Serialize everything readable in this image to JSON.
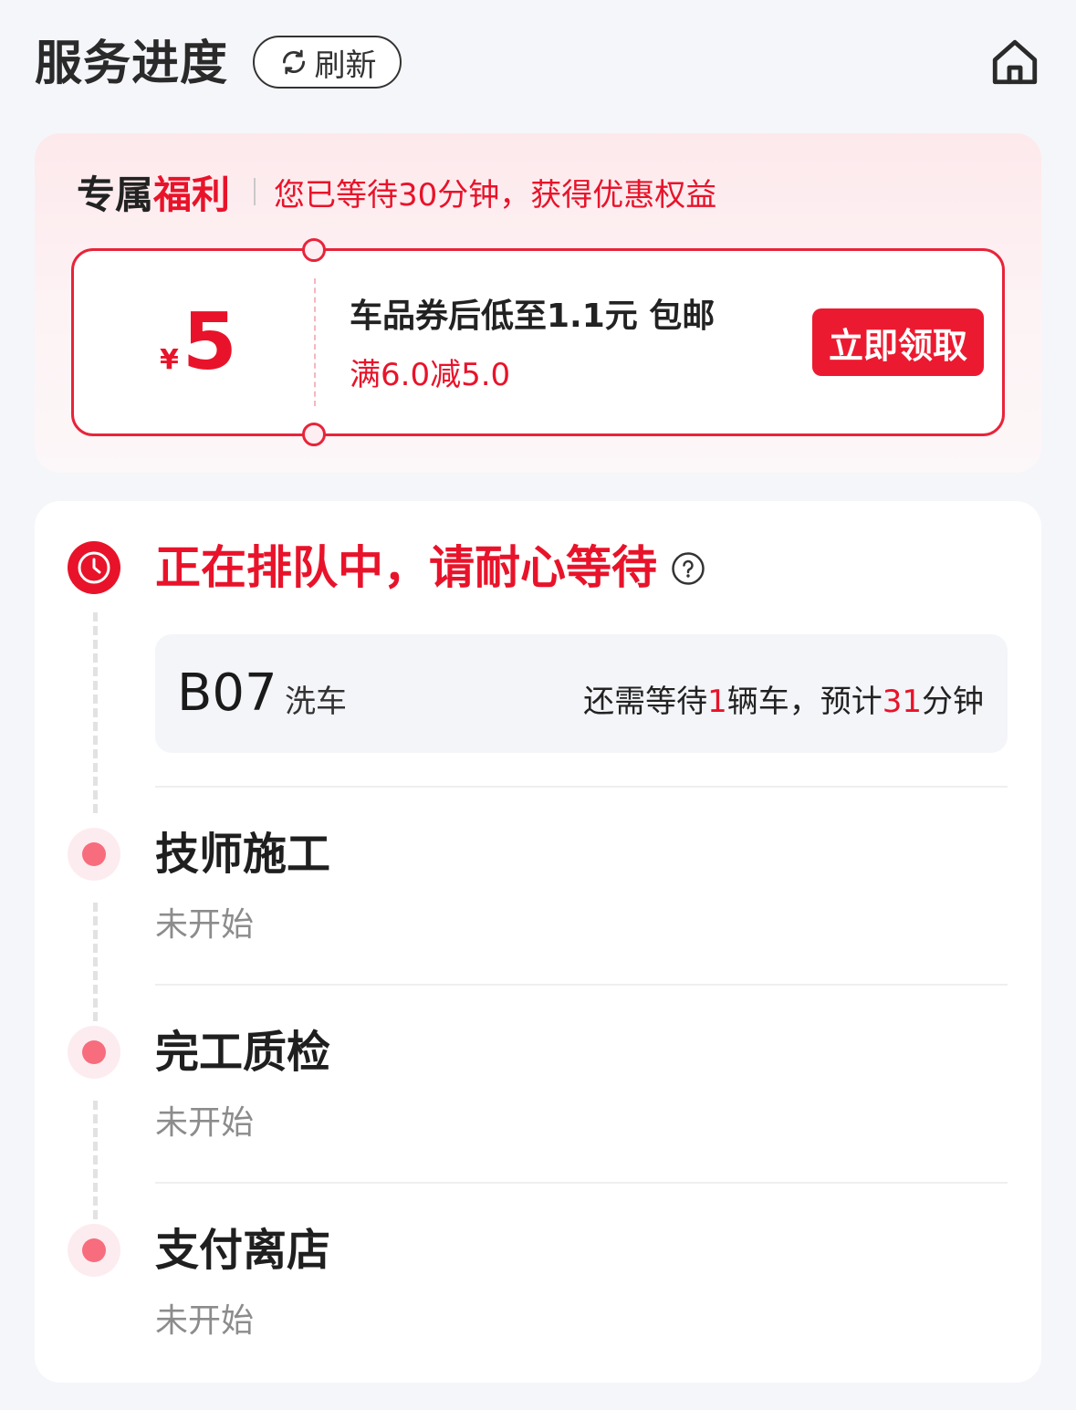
{
  "header": {
    "title": "服务进度",
    "refresh_label": "刷新"
  },
  "benefit": {
    "title_part1": "专属",
    "title_part2": "福利",
    "subtitle": "您已等待30分钟，获得优惠权益",
    "coupon": {
      "currency": "¥",
      "amount": "5",
      "title": "车品券后低至1.1元 包邮",
      "condition": "满6.0减5.0",
      "button_label": "立即领取"
    }
  },
  "progress": {
    "current_status": "正在排队中，请耐心等待",
    "queue": {
      "code": "B07",
      "service": "洗车",
      "wait_prefix": "还需等待",
      "cars": "1",
      "wait_middle": "辆车，预计",
      "minutes": "31",
      "wait_suffix": "分钟"
    },
    "steps": [
      {
        "title": "技师施工",
        "status": "未开始"
      },
      {
        "title": "完工质检",
        "status": "未开始"
      },
      {
        "title": "支付离店",
        "status": "未开始"
      }
    ]
  },
  "colors": {
    "accent": "#e8132a",
    "dot": "#f76d7d"
  }
}
